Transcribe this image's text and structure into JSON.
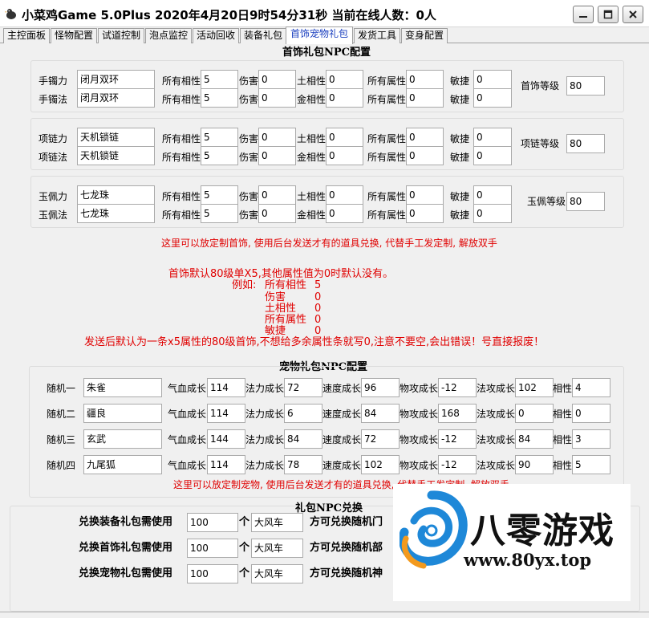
{
  "window": {
    "title": "小菜鸡Game 5.0Plus 2020年4月20日9时54分31秒 当前在线人数：0人"
  },
  "tabs": [
    "主控面板",
    "怪物配置",
    "试道控制",
    "泡点监控",
    "活动回收",
    "装备礼包",
    "首饰宠物礼包",
    "发货工具",
    "变身配置"
  ],
  "active_tab": "首饰宠物礼包",
  "jewelry": {
    "title": "首饰礼包NPC配置",
    "attr_labels": {
      "all_phase": "所有相性",
      "damage": "伤害",
      "earth_phase": "土相性",
      "metal_phase": "金相性",
      "all_attr": "所有属性",
      "agility": "敏捷"
    },
    "groups": [
      {
        "level_label": "首饰等级",
        "level_value": "80",
        "rows": [
          {
            "label": "手镯力",
            "name": "闭月双环",
            "all_phase": "5",
            "damage": "0",
            "phase_label": "土相性",
            "phase": "0",
            "all_attr": "0",
            "agility": "0"
          },
          {
            "label": "手镯法",
            "name": "闭月双环",
            "all_phase": "5",
            "damage": "0",
            "phase_label": "金相性",
            "phase": "0",
            "all_attr": "0",
            "agility": "0"
          }
        ]
      },
      {
        "level_label": "项链等级",
        "level_value": "80",
        "rows": [
          {
            "label": "项链力",
            "name": "天机锁链",
            "all_phase": "5",
            "damage": "0",
            "phase_label": "土相性",
            "phase": "0",
            "all_attr": "0",
            "agility": "0"
          },
          {
            "label": "项链法",
            "name": "天机锁链",
            "all_phase": "5",
            "damage": "0",
            "phase_label": "金相性",
            "phase": "0",
            "all_attr": "0",
            "agility": "0"
          }
        ]
      },
      {
        "level_label": "玉佩等级",
        "level_value": "80",
        "rows": [
          {
            "label": "玉佩力",
            "name": "七龙珠",
            "all_phase": "5",
            "damage": "0",
            "phase_label": "土相性",
            "phase": "0",
            "all_attr": "0",
            "agility": "0"
          },
          {
            "label": "玉佩法",
            "name": "七龙珠",
            "all_phase": "5",
            "damage": "0",
            "phase_label": "金相性",
            "phase": "0",
            "all_attr": "0",
            "agility": "0"
          }
        ]
      }
    ],
    "note_main": "这里可以放定制首饰, 使用后台发送才有的道具兑换, 代替手工发定制, 解放双手",
    "note_default": "首饰默认80级单X5,其他属性值为0时默认没有。",
    "example_label": "例如:",
    "example_rows": [
      {
        "name": "所有相性",
        "value": "5"
      },
      {
        "name": "伤害",
        "value": "0"
      },
      {
        "name": "土相性",
        "value": "0"
      },
      {
        "name": "所有属性",
        "value": "0"
      },
      {
        "name": "敏捷",
        "value": "0"
      }
    ],
    "warning": "发送后默认为一条x5属性的80级首饰,不想给多余属性条就写0,注意不要空,会出错误！号直接报废！"
  },
  "pet": {
    "title": "宠物礼包NPC配置",
    "col_labels": [
      "气血成长",
      "法力成长",
      "速度成长",
      "物攻成长",
      "法攻成长",
      "相性"
    ],
    "rows": [
      {
        "label": "随机一",
        "name": "朱雀",
        "values": [
          "114",
          "72",
          "96",
          "-12",
          "102",
          "4"
        ]
      },
      {
        "label": "随机二",
        "name": "疆良",
        "values": [
          "114",
          "6",
          "84",
          "168",
          "0",
          "0"
        ]
      },
      {
        "label": "随机三",
        "name": "玄武",
        "values": [
          "144",
          "84",
          "72",
          "-12",
          "84",
          "3"
        ]
      },
      {
        "label": "随机四",
        "name": "九尾狐",
        "values": [
          "114",
          "78",
          "102",
          "-12",
          "90",
          "5"
        ]
      }
    ],
    "note": "这里可以放定制宠物, 使用后台发送才有的道具兑换, 代替手工发定制, 解放双手"
  },
  "exchange": {
    "title": "礼包NPC兑换",
    "unit_label": "个",
    "rows": [
      {
        "label": "兑换装备礼包需使用",
        "count": "100",
        "item": "大风车",
        "suffix": "方可兑换随机门"
      },
      {
        "label": "兑换首饰礼包需使用",
        "count": "100",
        "item": "大风车",
        "suffix": "方可兑换随机部"
      },
      {
        "label": "兑换宠物礼包需使用",
        "count": "100",
        "item": "大风车",
        "suffix": "方可兑换随机神"
      }
    ]
  },
  "watermark": {
    "name": "八零游戏",
    "url": "www.80yx.top"
  },
  "colors": {
    "note_red": "#e00000",
    "active_tab_text": "#1a3fbf",
    "logo_blue": "#1e88d8",
    "logo_orange": "#f39a1e"
  },
  "icons": {
    "app": "chicken-icon",
    "minimize": "minimize-icon",
    "maximize": "maximize-icon",
    "close": "close-icon"
  }
}
